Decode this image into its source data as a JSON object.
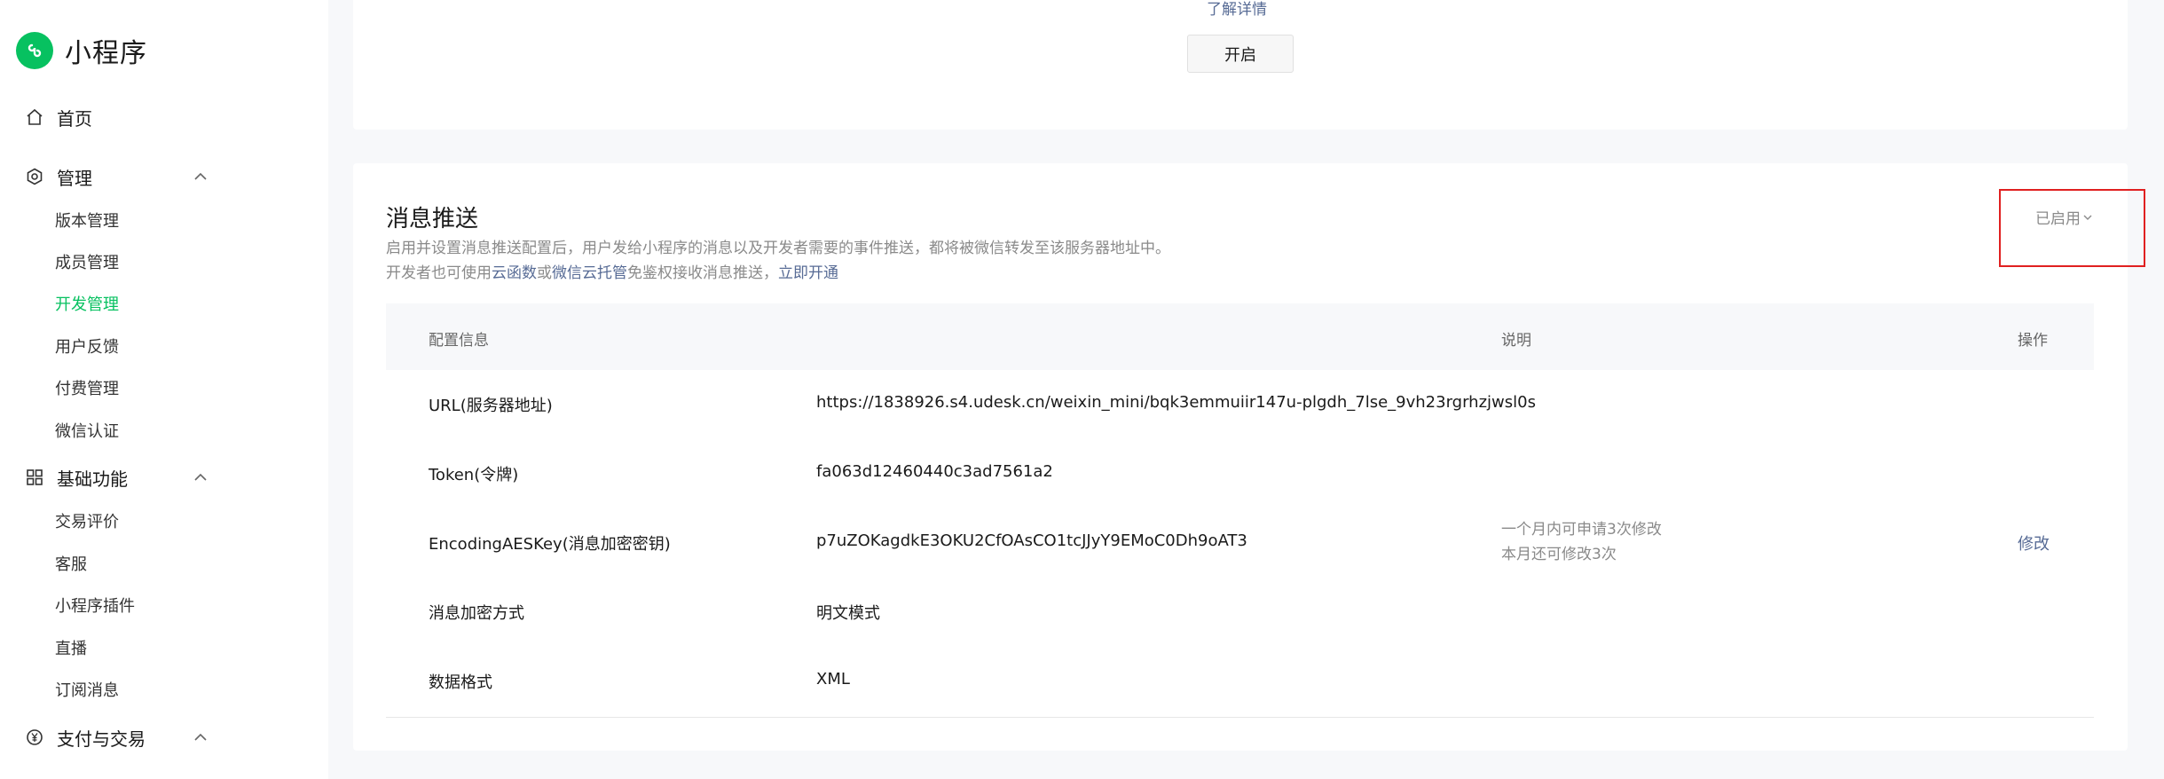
{
  "brand": {
    "title": "小程序",
    "logo_icon": "miniprogram-logo-icon",
    "color": "#07c160"
  },
  "sidebar": {
    "home": {
      "label": "首页",
      "icon": "home-icon"
    },
    "manage": {
      "label": "管理",
      "icon": "hexagon-gear-icon",
      "items": [
        "版本管理",
        "成员管理",
        "开发管理",
        "用户反馈",
        "付费管理",
        "微信认证"
      ],
      "active": "开发管理"
    },
    "basic": {
      "label": "基础功能",
      "icon": "grid-icon",
      "items": [
        "交易评价",
        "客服",
        "小程序插件",
        "直播",
        "订阅消息"
      ]
    },
    "pay": {
      "label": "支付与交易",
      "icon": "yen-icon"
    }
  },
  "top_card": {
    "link_text": "了解详情",
    "open_button": "开启"
  },
  "message_push": {
    "title": "消息推送",
    "desc1": "启用并设置消息推送配置后，用户发给小程序的消息以及开发者需要的事件推送，都将被微信转发至该服务器地址中。",
    "desc2_prefix": "开发者也可使用",
    "desc2_link1": "云函数",
    "desc2_or": "或",
    "desc2_link2": "微信云托管",
    "desc2_suffix": "免鉴权接收消息推送，",
    "desc2_link3": "立即开通",
    "status": "已启用",
    "table": {
      "headers": {
        "config": "配置信息",
        "note": "说明",
        "action": "操作"
      },
      "rows": [
        {
          "label": "URL(服务器地址)",
          "value": "https://1838926.s4.udesk.cn/weixin_mini/bqk3emmuiir147u-plgdh_7lse_9vh23rgrhzjwsl0s"
        },
        {
          "label": "Token(令牌)",
          "value": "fa063d12460440c3ad7561a2"
        },
        {
          "label": "EncodingAESKey(消息加密密钥)",
          "value": "p7uZOKagdkE3OKU2CfOAsCO1tcJJyY9EMoC0Dh9oAT3",
          "note1": "一个月内可申请3次修改",
          "note2": "本月还可修改3次",
          "action": "修改"
        },
        {
          "label": "消息加密方式",
          "value": "明文模式"
        },
        {
          "label": "数据格式",
          "value": "XML"
        }
      ]
    }
  }
}
